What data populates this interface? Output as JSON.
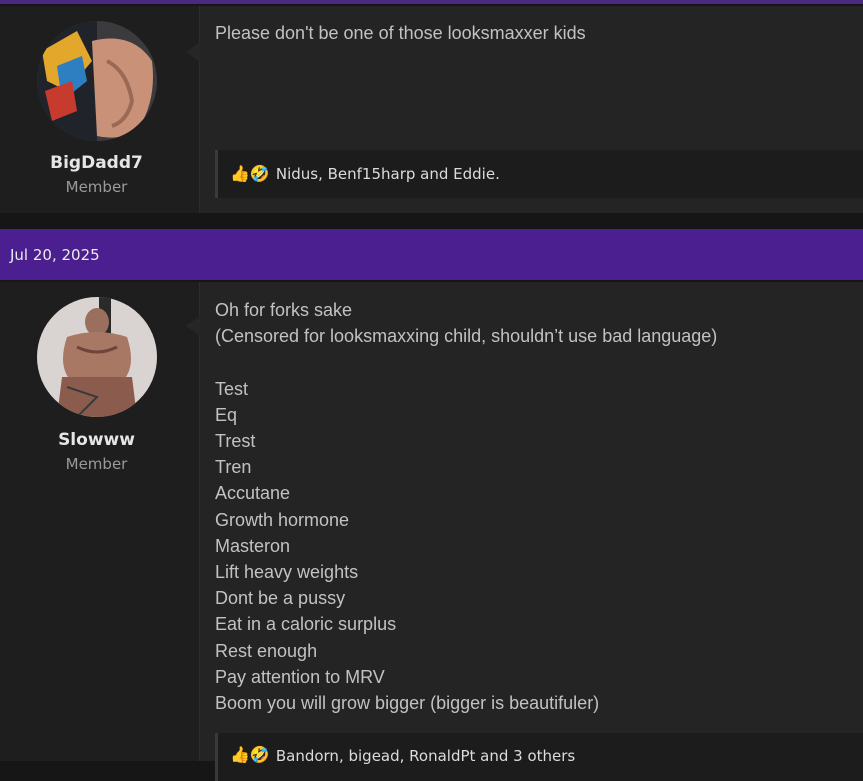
{
  "posts": [
    {
      "username": "BigDadd7",
      "role": "Member",
      "message_lines": [
        "Please don't be one of those looksmaxxer kids"
      ],
      "reactions": {
        "icons": [
          "thumbs-up-icon",
          "laughing-face-icon"
        ],
        "text": "Nidus, Benf15harp and Eddie."
      }
    },
    {
      "date": "Jul 20, 2025",
      "username": "Slowww",
      "role": "Member",
      "message_lines": [
        "Oh for forks sake",
        "(Censored for looksmaxxing child, shouldn’t use bad language)",
        "",
        "Test",
        "Eq",
        "Trest",
        "Tren",
        "Accutane",
        "Growth hormone",
        "Masteron",
        "Lift heavy weights",
        "Dont be a pussy",
        "Eat in a caloric surplus",
        "Rest enough",
        "Pay attention to MRV",
        "Boom you will grow bigger (bigger is beautifuler)"
      ],
      "reactions": {
        "icons": [
          "thumbs-up-icon",
          "laughing-face-icon"
        ],
        "text": "Bandorn, bigead, RonaldPt and 3 others"
      }
    }
  ],
  "colors": {
    "accent": "#4b1f8f",
    "post_bg": "#242424",
    "user_col_bg": "#1e1e1e",
    "text": "#c2c2c2"
  }
}
